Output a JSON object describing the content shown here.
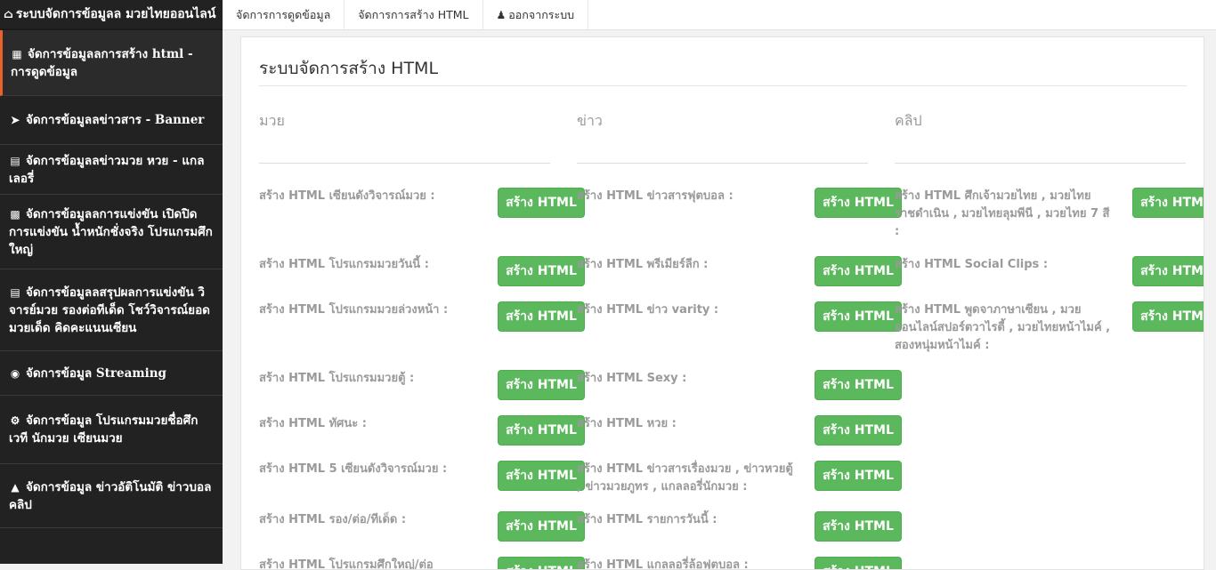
{
  "sidebar": {
    "brand": "ระบบจัดการข้อมูลล มวยไทยออนไลน์",
    "brand_icon": "home-icon",
    "items": [
      {
        "label": "จัดการข้อมูลลการสร้าง html - การดูดข้อมูล",
        "icon": "th-large-icon"
      },
      {
        "label": "จัดการข้อมูลลข่าวสาร - Banner",
        "icon": "chevron-circle-icon"
      },
      {
        "label": "จัดการข้อมูลลข่าวมวย หวย - แกลเลอรี่",
        "icon": "server-icon"
      },
      {
        "label": "จัดการข้อมูลลการแข่งขัน เปิดปิดการแข่งขัน น้ำหนักชั่งจริง โปรแกรมศึกใหญ่",
        "icon": "bar-chart-icon"
      },
      {
        "label": "จัดการข้อมูลลสรุปผลการแข่งขัน วิจารย์มวย รองต่อทีเด็ด โชว์วิจารณ์ยอดมวยเด็ด คิดคะแนนเซียน",
        "icon": "file-icon"
      },
      {
        "label": "จัดการข้อมูล Streaming",
        "icon": "camera-icon"
      },
      {
        "label": "จัดการข้อมูล โปรแกรมมวยชื่อศึก เวที นักมวย เซียนมวย",
        "icon": "gear-icon"
      },
      {
        "label": "จัดการข้อมูล ข่าวอัติโนมัติ ข่าวบอลคลิป",
        "icon": "sitemap-icon"
      }
    ]
  },
  "topnav": {
    "links": [
      "จัดการการดูดข้อมูล",
      "จัดการการสร้าง HTML",
      "ออกจากระบบ"
    ],
    "logout_icon": "user-icon"
  },
  "main": {
    "title": "ระบบจัดการสร้าง HTML",
    "button_label": "สร้าง HTML",
    "columns": [
      {
        "heading": "มวย",
        "rows": [
          "สร้าง HTML เซียนดังวิจารณ์มวย :",
          "สร้าง HTML โปรแกรมมวยวันนี้ :",
          "สร้าง HTML โปรแกรมมวยล่วงหน้า :",
          "สร้าง HTML โปรแกรมมวยตู้ :",
          "สร้าง HTML ทัศนะ :",
          "สร้าง HTML 5 เซียนดังวิจารณ์มวย :",
          "สร้าง HTML รอง/ต่อ/ทีเด็ด :",
          "สร้าง HTML โปรแกรมศึกใหญ่/ต่อ"
        ]
      },
      {
        "heading": "ข่าว",
        "rows": [
          "สร้าง HTML ข่าวสารฟุตบอล :",
          "สร้าง HTML พรีเมียร์ลีก :",
          "สร้าง HTML ข่าว varity :",
          "สร้าง HTML Sexy :",
          "สร้าง HTML หวย :",
          "สร้าง HTML ข่าวสารเรื่องมวย , ข่าวหวยตู้ , ข่าวมวยภูทร , แกลลอรี่นักมวย :",
          "สร้าง HTML รายการวันนี้ :",
          "สร้าง HTML แกลลอรี่ล้อฟุตบอล :"
        ]
      },
      {
        "heading": "คลิป",
        "rows": [
          "สร้าง HTML ศึกเจ้ามวยไทย , มวยไทยราชดำเนิน , มวยไทยลุมพีนี , มวยไทย 7 สี :",
          "สร้าง HTML Social Clips :",
          "สร้าง HTML พูดจาภาษาเซียน , มวยออนไลน์สปอร์ตวาไรตี้ , มวยไทยหน้าไมค์ , สองหนุ่มหน้าไมค์ :"
        ]
      }
    ]
  }
}
